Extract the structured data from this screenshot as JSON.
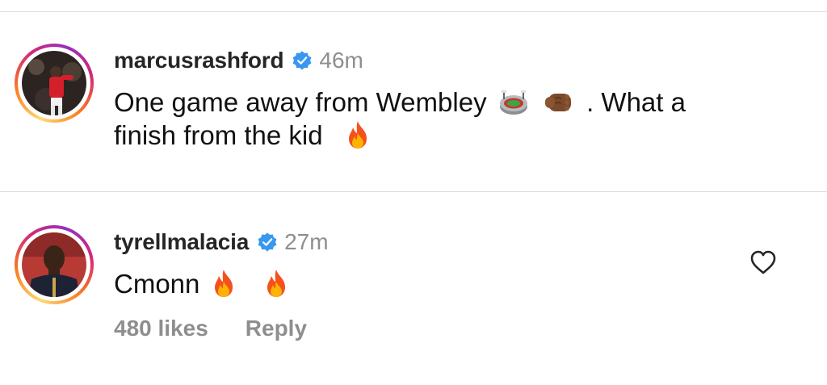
{
  "comments": [
    {
      "username": "marcusrashford",
      "verified_icon": "verified-badge-icon",
      "time": "46m",
      "text_parts": [
        "One game away from Wembley",
        ". What a",
        "finish from the kid"
      ],
      "emojis": [
        "stadium-emoji",
        "fist-emoji",
        "fire-emoji"
      ]
    },
    {
      "username": "tyrellmalacia",
      "verified_icon": "verified-badge-icon",
      "time": "27m",
      "text_parts": [
        "Cmonn"
      ],
      "emojis": [
        "fire-emoji",
        "fire-emoji"
      ],
      "likes": "480 likes",
      "reply_label": "Reply",
      "like_icon": "heart-outline-icon"
    }
  ],
  "colors": {
    "username": "#262626",
    "meta": "#8e8e8e",
    "verified": "#3897f0",
    "divider": "#dbdbdb"
  }
}
